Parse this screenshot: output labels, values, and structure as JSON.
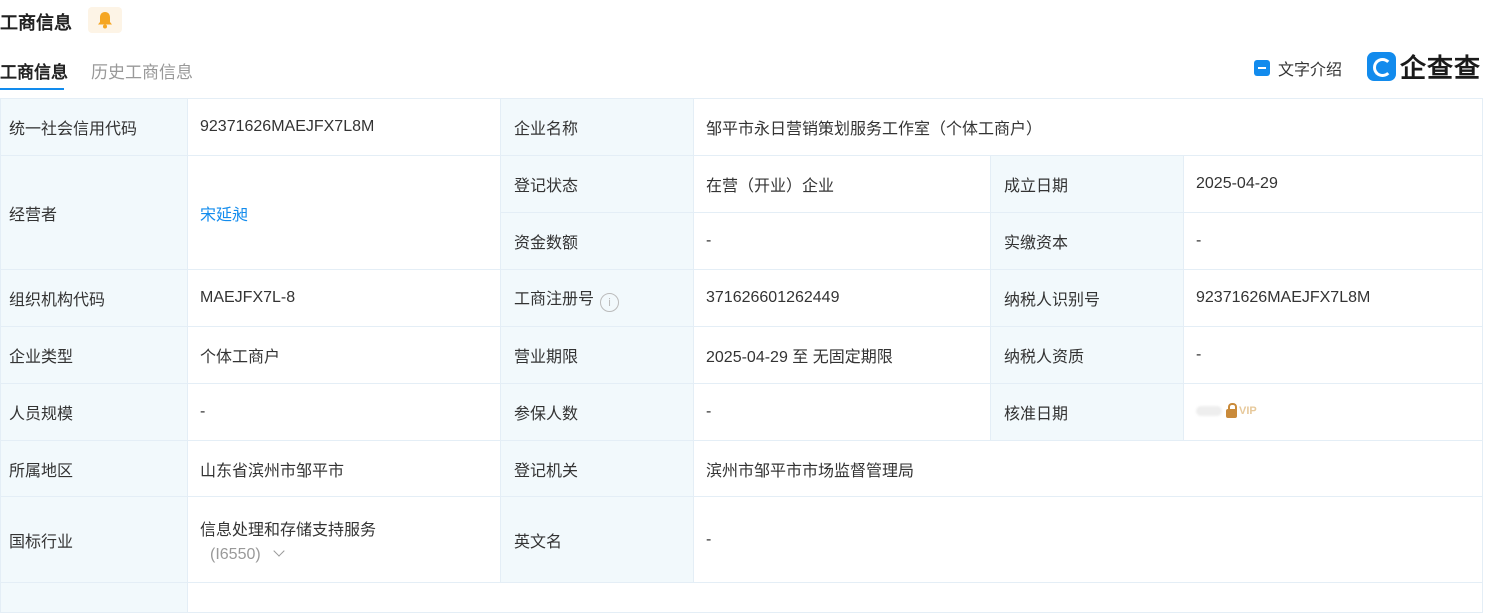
{
  "header": {
    "title": "工商信息",
    "tabs": [
      "工商信息",
      "历史工商信息"
    ],
    "intro_label": "文字介绍",
    "logo_text": "企查查"
  },
  "icons": {
    "bell": "bell-icon",
    "intro": "document-icon",
    "logo": "qichacha-logo-icon",
    "info": "info-icon",
    "lock": "lock-icon",
    "chevron": "chevron-down-icon"
  },
  "colors": {
    "accent": "#128bed",
    "label_bg": "#f2f9fc",
    "border": "#e4eef6",
    "bell_bg": "#fdf4e6",
    "bell": "#f5a623"
  },
  "fields": {
    "credit_code_label": "统一社会信用代码",
    "credit_code": "92371626MAEJFX7L8M",
    "company_name_label": "企业名称",
    "company_name": "邹平市永日营销策划服务工作室（个体工商户）",
    "operator_label": "经营者",
    "operator": "宋延昶",
    "status_label": "登记状态",
    "status": "在营（开业）企业",
    "established_label": "成立日期",
    "established": "2025-04-29",
    "capital_label": "资金数额",
    "capital": "-",
    "paid_capital_label": "实缴资本",
    "paid_capital": "-",
    "org_code_label": "组织机构代码",
    "org_code": "MAEJFX7L-8",
    "reg_no_label": "工商注册号",
    "reg_no": "371626601262449",
    "tax_id_label": "纳税人识别号",
    "tax_id": "92371626MAEJFX7L8M",
    "type_label": "企业类型",
    "type": "个体工商户",
    "term_label": "营业期限",
    "term": "2025-04-29 至 无固定期限",
    "tax_qual_label": "纳税人资质",
    "tax_qual": "-",
    "staff_label": "人员规模",
    "staff": "-",
    "insured_label": "参保人数",
    "insured": "-",
    "approve_label": "核准日期",
    "approve_vip": "VIP",
    "region_label": "所属地区",
    "region": "山东省滨州市邹平市",
    "authority_label": "登记机关",
    "authority": "滨州市邹平市市场监督管理局",
    "industry_label": "国标行业",
    "industry": "信息处理和存储支持服务",
    "industry_code": "(I6550)",
    "english_label": "英文名",
    "english": "-"
  }
}
